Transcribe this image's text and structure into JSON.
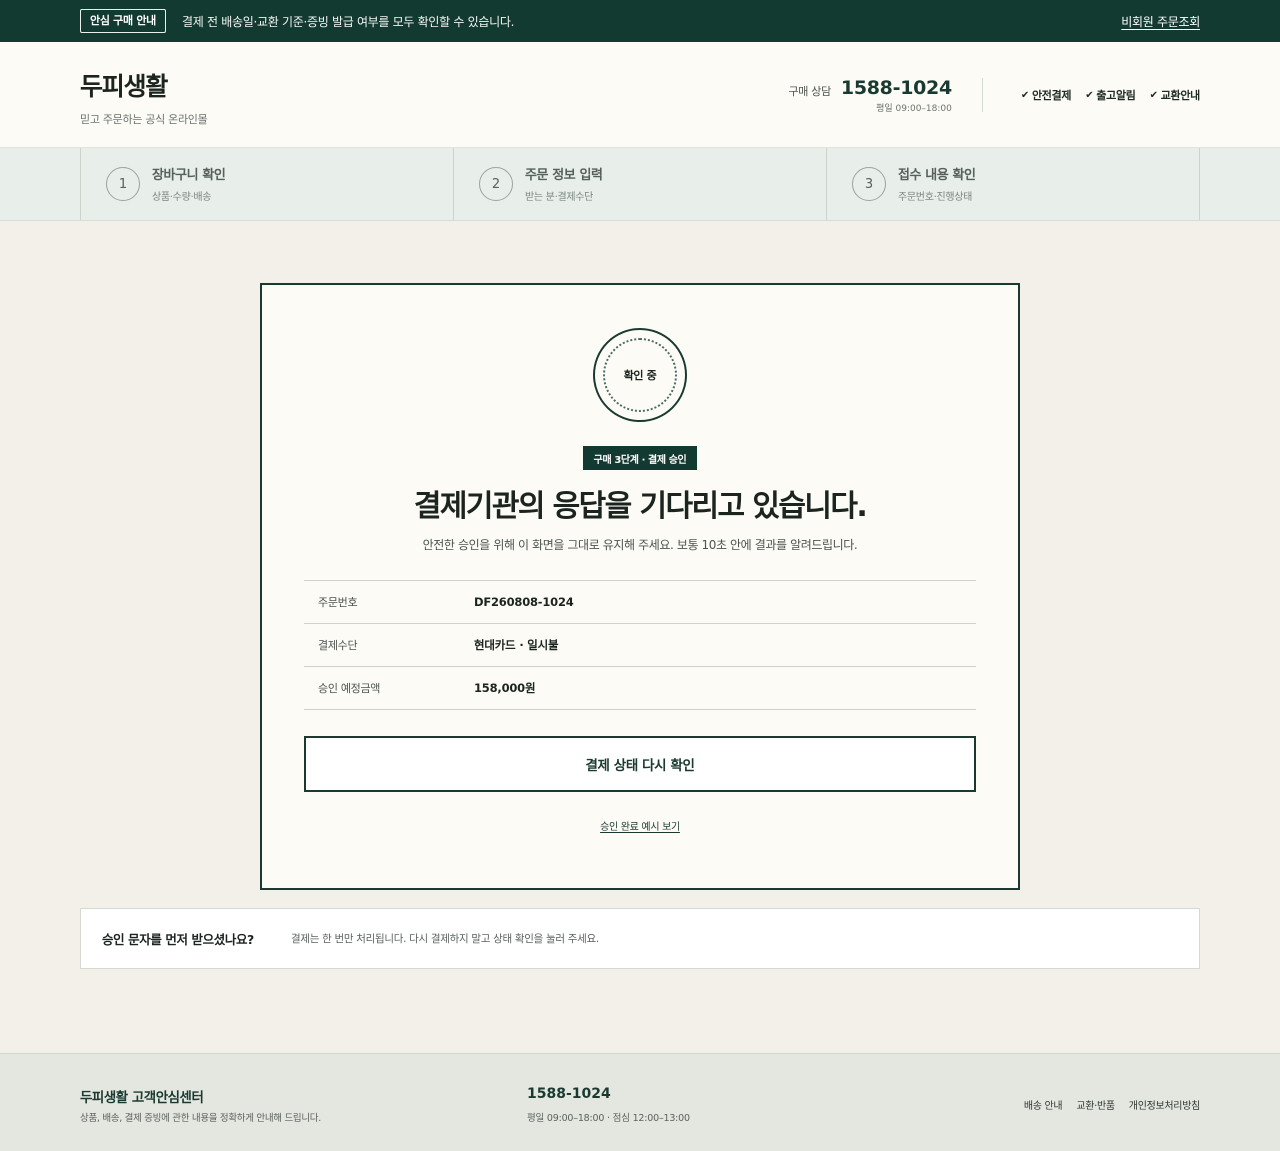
{
  "topbar": {
    "badge": "안심 구매 안내",
    "notice": "결제 전 배송일·교환 기준·증빙 발급 여부를 모두 확인할 수 있습니다.",
    "link": "비회원 주문조회"
  },
  "header": {
    "brand": "두피생활",
    "tagline": "믿고 주문하는 공식 온라인몰",
    "contact_label": "구매 상담",
    "phone": "1588-1024",
    "hours": "평일 09:00–18:00",
    "assurances": [
      {
        "icon": "check-icon",
        "label": "안전결제"
      },
      {
        "icon": "check-icon",
        "label": "출고알림"
      },
      {
        "icon": "check-icon",
        "label": "교환안내"
      }
    ]
  },
  "steps": [
    {
      "num": "1",
      "title": "장바구니 확인",
      "sub": "상품·수량·배송"
    },
    {
      "num": "2",
      "title": "주문 정보 입력",
      "sub": "받는 분·결제수단"
    },
    {
      "num": "3",
      "title": "접수 내용 확인",
      "sub": "주문번호·진행상태"
    }
  ],
  "card": {
    "status": "확인 중",
    "step_tag": "구매 3단계 · 결제 승인",
    "title": "결제기관의 응답을 기다리고 있습니다.",
    "subtitle": "안전한 승인을 위해 이 화면을 그대로 유지해 주세요. 보통 10초 안에 결과를 알려드립니다.",
    "info": [
      {
        "label": "주문번호",
        "value": "DF260808-1024"
      },
      {
        "label": "결제수단",
        "value": "현대카드 · 일시불"
      },
      {
        "label": "승인 예정금액",
        "value": "158,000원"
      }
    ],
    "primary_button": "결제 상태 다시 확인",
    "sample_link": "승인 완료 예시 보기"
  },
  "help": {
    "title": "승인 문자를 먼저 받으셨나요?",
    "text": "결제는 한 번만 처리됩니다. 다시 결제하지 말고 상태 확인을 눌러 주세요."
  },
  "footer": {
    "name": "두피생활 고객안심센터",
    "desc": "상품, 배송, 결제 증빙에 관한 내용을 정확하게 안내해 드립니다.",
    "phone": "1588-1024",
    "hours": "평일 09:00–18:00 · 점심 12:00–13:00",
    "links": [
      "배송 안내",
      "교환·반품",
      "개인정보처리방침"
    ]
  },
  "colors": {
    "brand_dark": "#133a31",
    "page_bg": "#f3f0ea",
    "card_bg": "#fcfbf6"
  }
}
